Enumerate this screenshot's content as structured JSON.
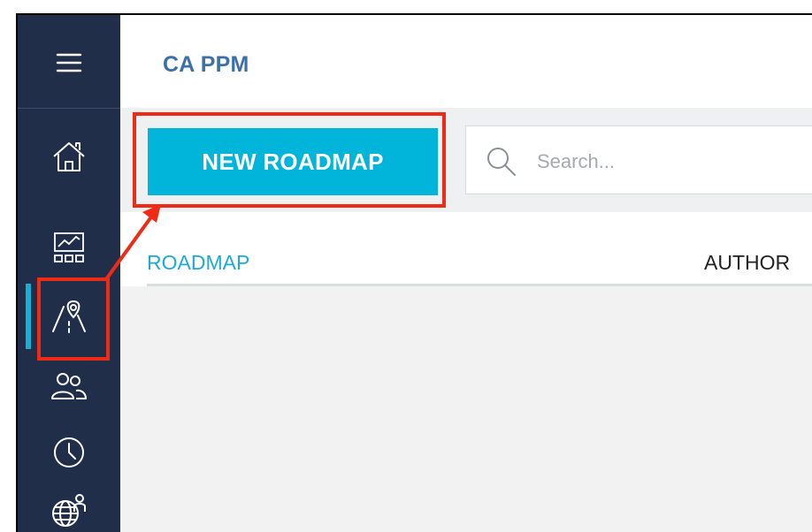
{
  "app": {
    "title": "CA PPM"
  },
  "toolbar": {
    "new_button_label": "NEW ROADMAP",
    "search_placeholder": "Search..."
  },
  "table": {
    "columns": [
      "ROADMAP",
      "AUTHOR"
    ]
  },
  "sidebar": {
    "items": [
      {
        "icon": "menu-icon"
      },
      {
        "icon": "home-icon"
      },
      {
        "icon": "dashboard-icon"
      },
      {
        "icon": "roadmap-icon",
        "active": true
      },
      {
        "icon": "people-icon"
      },
      {
        "icon": "clock-icon"
      },
      {
        "icon": "globe-person-icon"
      }
    ]
  },
  "colors": {
    "sidebar_bg": "#212e4a",
    "accent": "#00b5d9",
    "title": "#3b70a8",
    "annotation": "#ee2b14"
  }
}
